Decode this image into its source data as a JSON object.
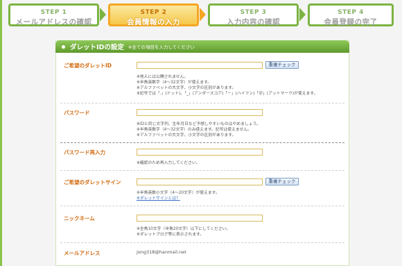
{
  "steps": [
    {
      "num": "STEP 1",
      "label": "メールアドレスの確認",
      "state": "done"
    },
    {
      "num": "STEP 2",
      "label": "会員情報の入力",
      "state": "active"
    },
    {
      "num": "STEP 3",
      "label": "入力内容の確認",
      "state": "future"
    },
    {
      "num": "STEP 4",
      "label": "会員登録の完了",
      "state": "future"
    }
  ],
  "panel": {
    "title": "ダレットIDの設定",
    "note": "※全ての項目を入力してください"
  },
  "fields": {
    "dalet_id": {
      "label": "ご希望のダレットID",
      "value": "",
      "button": "重複チェック",
      "notes": [
        "※他人には公開されません。",
        "※半角英数字（4～32文字）が使えます。",
        "※アルファベットの大文字、小文字の区別があります。",
        "※記号では「.」(ドット)、「_」(アンダースコア)「－」(ハイフン)「＠」(アットマーク)が使えます。"
      ]
    },
    "password": {
      "label": "パスワード",
      "value": "",
      "notes": [
        "※IDと同じ文字列、生年月日など予想しやすいものはやめましょう。",
        "※半角英数字（4～32文字）のみ使えます。記号は使えません。",
        "※アルファベットの大文字、小文字の区別があります。"
      ]
    },
    "password_confirm": {
      "label": "パスワード再入力",
      "value": "",
      "notes": [
        "※確認のため再入力してください。"
      ]
    },
    "dalet_sign": {
      "label": "ご希望のダレットサイン",
      "value": "",
      "button": "重複チェック",
      "notes": [
        "※半角英数小文字（4～20文字）が使えます。"
      ],
      "link": "※ダレットサインとは？"
    },
    "nickname": {
      "label": "ニックネーム",
      "value": "",
      "notes": [
        "※全角10文字（半角20文字）以下にしてください。",
        "※ダレットブログ等に表示されます。"
      ]
    },
    "email": {
      "label": "メールアドレス",
      "value": "jong318@hanmail.net"
    }
  }
}
